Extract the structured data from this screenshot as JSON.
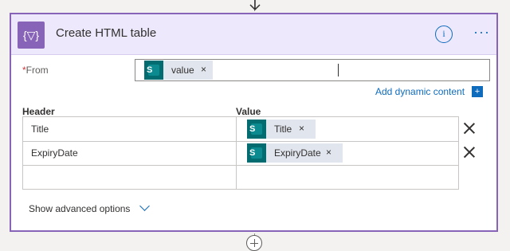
{
  "action": {
    "title": "Create HTML table",
    "icon": "data-operation-icon"
  },
  "from": {
    "label": "From",
    "required_mark": "*",
    "token": {
      "label": "value",
      "remove": "×",
      "icon": "sharepoint-icon"
    }
  },
  "dynamic_content": {
    "label": "Add dynamic content",
    "plus": "+"
  },
  "table": {
    "header_col": "Header",
    "value_col": "Value",
    "rows": [
      {
        "header": "Title",
        "value_token": "Title",
        "remove": "×"
      },
      {
        "header": "ExpiryDate",
        "value_token": "ExpiryDate",
        "remove": "×"
      },
      {
        "header": "",
        "value_token": ""
      }
    ]
  },
  "advanced": {
    "label": "Show advanced options"
  },
  "colors": {
    "accent": "#8764b8",
    "header_bg": "#ede8fb",
    "link": "#0f6cbd",
    "sharepoint": "#036c70"
  }
}
